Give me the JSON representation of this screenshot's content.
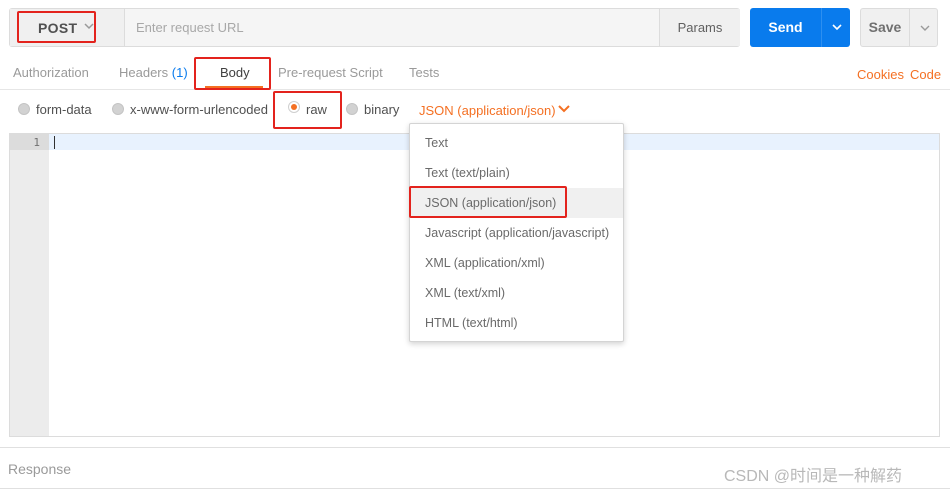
{
  "request": {
    "method": "POST",
    "url_placeholder": "Enter request URL",
    "url_value": "",
    "params_label": "Params",
    "send_label": "Send",
    "save_label": "Save"
  },
  "tabs": {
    "authorization": "Authorization",
    "headers": "Headers",
    "headers_count": "(1)",
    "body": "Body",
    "pre_request": "Pre-request Script",
    "tests": "Tests",
    "cookies": "Cookies",
    "code": "Code"
  },
  "body_options": {
    "form_data": "form-data",
    "urlencoded": "x-www-form-urlencoded",
    "raw": "raw",
    "binary": "binary",
    "selected": "raw",
    "content_type": "JSON (application/json)"
  },
  "editor": {
    "line_numbers": [
      "1"
    ]
  },
  "dropdown": {
    "items": [
      "Text",
      "Text (text/plain)",
      "JSON (application/json)",
      "Javascript (application/javascript)",
      "XML (application/xml)",
      "XML (text/xml)",
      "HTML (text/html)"
    ],
    "selected": "JSON (application/json)"
  },
  "response": {
    "label": "Response"
  },
  "watermark": "CSDN @时间是一种解药",
  "colors": {
    "accent": "#f47023",
    "send": "#097bed",
    "highlight": "#e3231d"
  }
}
